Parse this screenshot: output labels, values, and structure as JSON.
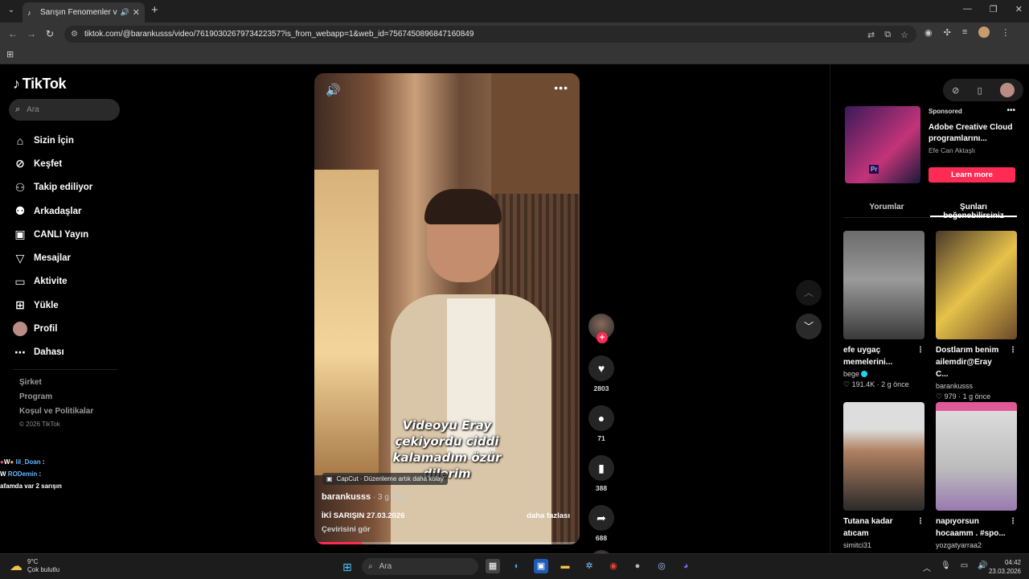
{
  "browser": {
    "tab_title": "Sarışın Fenomenler ve Baranı",
    "url": "tiktok.com/@barankusss/video/7619030267973422357?is_from_webapp=1&web_id=7567450896847160849"
  },
  "sidebar": {
    "logo": "TikTok",
    "search_placeholder": "Ara",
    "items": [
      {
        "label": "Sizin İçin",
        "icon": "home-icon",
        "glyph": "⌂"
      },
      {
        "label": "Keşfet",
        "icon": "compass-icon",
        "glyph": "⊘"
      },
      {
        "label": "Takip ediliyor",
        "icon": "following-icon",
        "glyph": "⚇"
      },
      {
        "label": "Arkadaşlar",
        "icon": "friends-icon",
        "glyph": "⚉"
      },
      {
        "label": "CANLI Yayın",
        "icon": "live-icon",
        "glyph": "▣"
      },
      {
        "label": "Mesajlar",
        "icon": "messages-icon",
        "glyph": "▽"
      },
      {
        "label": "Aktivite",
        "icon": "activity-icon",
        "glyph": "▭"
      },
      {
        "label": "Yükle",
        "icon": "upload-icon",
        "glyph": "⊞"
      },
      {
        "label": "Profil",
        "icon": "profile-avatar",
        "glyph": ""
      },
      {
        "label": "Dahası",
        "icon": "more-icon",
        "glyph": "⋯"
      }
    ],
    "footer_links": [
      "Şirket",
      "Program",
      "Koşul ve Politikalar"
    ],
    "copyright": "© 2026 TikTok"
  },
  "overlay_chat": [
    {
      "name": "lil_Doan",
      "text": ":"
    },
    {
      "name": "RODemin",
      "text": ":"
    },
    {
      "name": "",
      "text": "afamda var 2 sarışın"
    }
  ],
  "video": {
    "caption": "Videoyu Eray çekiyordu ciddi kalamadım özür dilerim",
    "capcut_label": "CapCut · Düzenleme artık daha kolay",
    "author": "barankusss",
    "posted_ago": " · 3 g önce",
    "description": "İKİ SARIŞIN 27.03.2026",
    "more_label": "daha fazlası",
    "translate_label": "Çevirisini gör",
    "progress": 0.18
  },
  "actions": {
    "likes": "2803",
    "comments": "71",
    "saves": "388",
    "shares": "688"
  },
  "right_panel": {
    "ad": {
      "sponsored": "Sponsored",
      "title": "Adobe Creative Cloud programlarını...",
      "advertiser": "Efe Can Aktaşlı",
      "cta": "Learn more",
      "thumb_label": "Pr"
    },
    "tabs": [
      "Yorumlar",
      "Şunları beğenebilirsiniz"
    ],
    "cards": [
      {
        "title": "efe uygaç memelerini...",
        "user": "bege",
        "verified": true,
        "meta": "♡ 191.4K · 2 g önce"
      },
      {
        "title": "Dostlarım benim ailemdir@Eray C...",
        "user": "barankusss",
        "verified": false,
        "meta": "♡ 979 · 1 g önce"
      },
      {
        "title": "Tutana kadar atıcam",
        "user": "simitci31",
        "verified": false,
        "meta": ""
      },
      {
        "title": "napıyorsun hocaamm . #spo...",
        "user": "yozgatyarraa2",
        "verified": false,
        "meta": ""
      }
    ]
  },
  "taskbar": {
    "weather_temp": "9°C",
    "weather_desc": "Çok bulutlu",
    "search_placeholder": "Ara",
    "time": "04:42",
    "date": "23.03.2026"
  }
}
